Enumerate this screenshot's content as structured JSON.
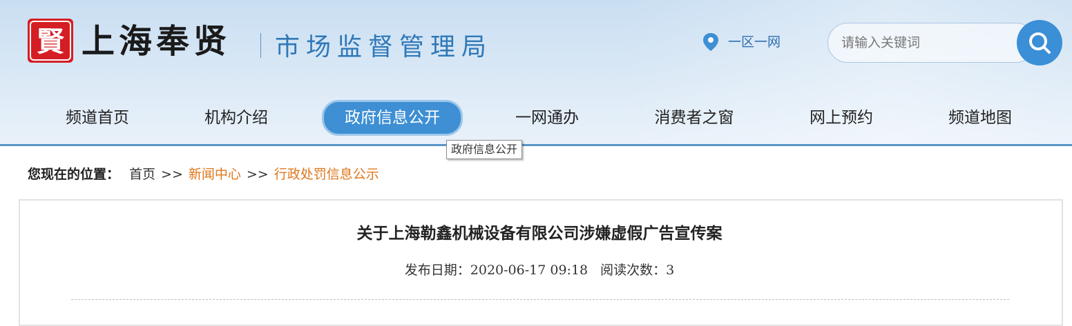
{
  "header": {
    "logo_seal_text": "賢",
    "logo_title": "上海奉贤",
    "logo_subtitle": "市场监督管理局",
    "location_label": "一区一网",
    "search": {
      "placeholder": "请输入关键词"
    },
    "colors": {
      "seal": "#d51d24",
      "accent": "#3e8fd3"
    }
  },
  "nav": {
    "items": [
      {
        "label": "频道首页"
      },
      {
        "label": "机构介绍"
      },
      {
        "label": "政府信息公开",
        "active": true
      },
      {
        "label": "一网通办"
      },
      {
        "label": "消费者之窗"
      },
      {
        "label": "网上预约"
      },
      {
        "label": "频道地图"
      }
    ],
    "tooltip": "政府信息公开"
  },
  "breadcrumb": {
    "label": "您现在的位置：",
    "home": "首页",
    "sep": ">>",
    "news": "新闻中心",
    "current": "行政处罚信息公示"
  },
  "article": {
    "title": "关于上海勒鑫机械设备有限公司涉嫌虚假广告宣传案",
    "date_label": "发布日期：",
    "date_value": "2020-06-17 09:18",
    "reads_label": "阅读次数：",
    "reads_value": "3"
  }
}
